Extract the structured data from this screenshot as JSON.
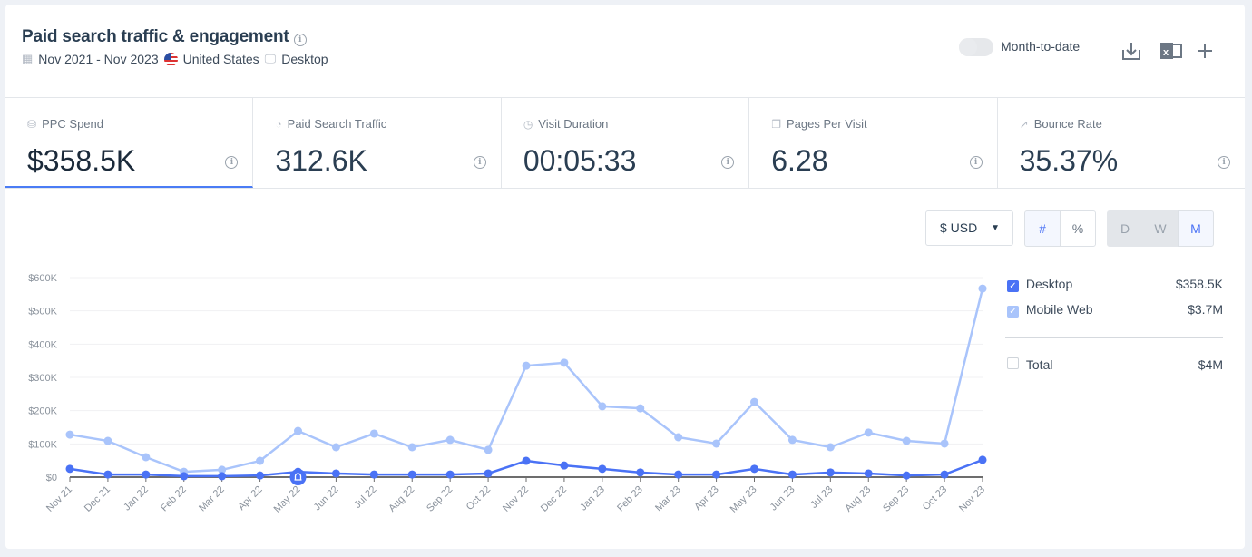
{
  "header": {
    "title": "Paid search traffic & engagement",
    "date_range": "Nov 2021 - Nov 2023",
    "country": "United States",
    "device": "Desktop",
    "month_to_date_label": "Month-to-date",
    "month_to_date_on": false
  },
  "kpis": [
    {
      "label": "PPC Spend",
      "value": "$358.5K",
      "icon": "database-coins-icon"
    },
    {
      "label": "Paid Search Traffic",
      "value": "312.6K",
      "icon": "pie-icon"
    },
    {
      "label": "Visit Duration",
      "value": "00:05:33",
      "icon": "clock-icon"
    },
    {
      "label": "Pages Per Visit",
      "value": "6.28",
      "icon": "pages-icon"
    },
    {
      "label": "Bounce Rate",
      "value": "35.37%",
      "icon": "bounce-icon"
    }
  ],
  "controls": {
    "currency": "$ USD",
    "number_toggle": [
      "#",
      "%"
    ],
    "granularity": [
      "D",
      "W",
      "M"
    ],
    "selected_granularity": "M",
    "selected_number": "#"
  },
  "legend": [
    {
      "label": "Desktop",
      "value": "$358.5K",
      "checked": true,
      "color": "#4a72f5"
    },
    {
      "label": "Mobile Web",
      "value": "$3.7M",
      "checked": true,
      "color": "#a9c4fb"
    },
    {
      "label": "Total",
      "value": "$4M",
      "checked": false
    }
  ],
  "chart_data": {
    "type": "line",
    "categories": [
      "Nov 21",
      "Dec 21",
      "Jan 22",
      "Feb 22",
      "Mar 22",
      "Apr 22",
      "May 22",
      "Jun 22",
      "Jul 22",
      "Aug 22",
      "Sep 22",
      "Oct 22",
      "Nov 22",
      "Dec 22",
      "Jan 23",
      "Feb 23",
      "Mar 23",
      "Apr 23",
      "May 23",
      "Jun 23",
      "Jul 23",
      "Aug 23",
      "Sep 23",
      "Oct 23",
      "Nov 23"
    ],
    "yticks": [
      "$0",
      "$100K",
      "$200K",
      "$300K",
      "$400K",
      "$500K",
      "$600K"
    ],
    "ylim": [
      0,
      600000
    ],
    "grid": true,
    "legend": "right",
    "series": [
      {
        "name": "Mobile Web",
        "color": "#a9c4fb",
        "values": [
          128000,
          109000,
          60000,
          16000,
          22000,
          49000,
          139000,
          90000,
          131000,
          90000,
          112000,
          82000,
          335000,
          344000,
          213000,
          207000,
          120000,
          101000,
          226000,
          112000,
          90000,
          134000,
          109000,
          101000,
          567000
        ]
      },
      {
        "name": "Desktop",
        "color": "#4a72f5",
        "values": [
          25000,
          8000,
          8000,
          3000,
          3000,
          5000,
          16000,
          11000,
          8000,
          8000,
          8000,
          11000,
          49000,
          35000,
          25000,
          14000,
          8000,
          8000,
          25000,
          8000,
          14000,
          11000,
          5000,
          8000,
          52000
        ]
      }
    ],
    "annotation": {
      "category": "May 22",
      "icon": "bell-icon"
    }
  }
}
